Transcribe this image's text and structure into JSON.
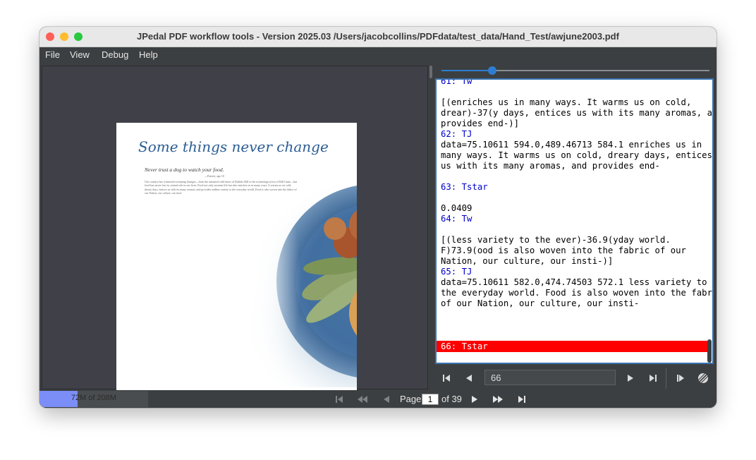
{
  "window": {
    "title": "JPedal PDF workflow tools - Version 2025.03 /Users/jacobcollins/PDFdata/test_data/Hand_Test/awjune2003.pdf"
  },
  "menu": [
    "File",
    "View",
    "Debug",
    "Help"
  ],
  "pdf_page": {
    "title": "Some things never change",
    "subtitle": "Never trust a dog to watch your food.",
    "attribution": "—Patrick, age 10",
    "body": "Our country has witnessed sweeping changes—from the untamed wild times of Buffalo Bill to the technological era of Bill Gates—but food has never lost its central role in our lives. Food not only sustains life but also enriches us in many ways. It warms us on cold, dreary days, entices us with its many aromas, and provides endless variety to the everyday world. Food is also woven into the fabric of our Nation, our culture, our insti-"
  },
  "operator_list": [
    {
      "text": "61: Tw",
      "kind": "op"
    },
    {
      "text": "",
      "kind": "text"
    },
    {
      "text": "[(enriches us in many ways. It warms us on cold,",
      "kind": "text"
    },
    {
      "text": "drear)-37(y days, entices us with its many aromas, and",
      "kind": "text"
    },
    {
      "text": "provides end-)]",
      "kind": "text"
    },
    {
      "text": "62: TJ",
      "kind": "op"
    },
    {
      "text": "data=75.10611 594.0,489.46713 584.1 enriches us in",
      "kind": "text"
    },
    {
      "text": "many ways. It warms us on cold, dreary days, entices",
      "kind": "text"
    },
    {
      "text": "us with its many aromas, and provides end-",
      "kind": "text"
    },
    {
      "text": "",
      "kind": "text"
    },
    {
      "text": "63: Tstar",
      "kind": "op"
    },
    {
      "text": "",
      "kind": "text"
    },
    {
      "text": "0.0409",
      "kind": "text"
    },
    {
      "text": "64: Tw",
      "kind": "op"
    },
    {
      "text": "",
      "kind": "text"
    },
    {
      "text": "[(less variety to the ever)-36.9(yday world.",
      "kind": "text"
    },
    {
      "text": "F)73.9(ood is also woven into the fabric of our",
      "kind": "text"
    },
    {
      "text": "Nation, our culture, our insti-)]",
      "kind": "text"
    },
    {
      "text": "65: TJ",
      "kind": "op"
    },
    {
      "text": "data=75.10611 582.0,474.74503 572.1 less variety to",
      "kind": "text"
    },
    {
      "text": "the everyday world. Food is also woven into the fabric",
      "kind": "text"
    },
    {
      "text": "of our Nation, our culture, our insti-",
      "kind": "text"
    }
  ],
  "selected_operator": "66: Tstar",
  "operator_slider": {
    "position_fraction": 0.19
  },
  "operator_nav": {
    "current": "66"
  },
  "status": {
    "memory": "72M of 208M",
    "memory_fraction": 0.35,
    "page_label": "Page",
    "page_current": "1",
    "page_total": "of 39"
  },
  "colors": {
    "accent": "#2f7dd1",
    "selection": "#ff0000",
    "op_text": "#0000cc",
    "memory_fill": "#7b8ef8"
  }
}
